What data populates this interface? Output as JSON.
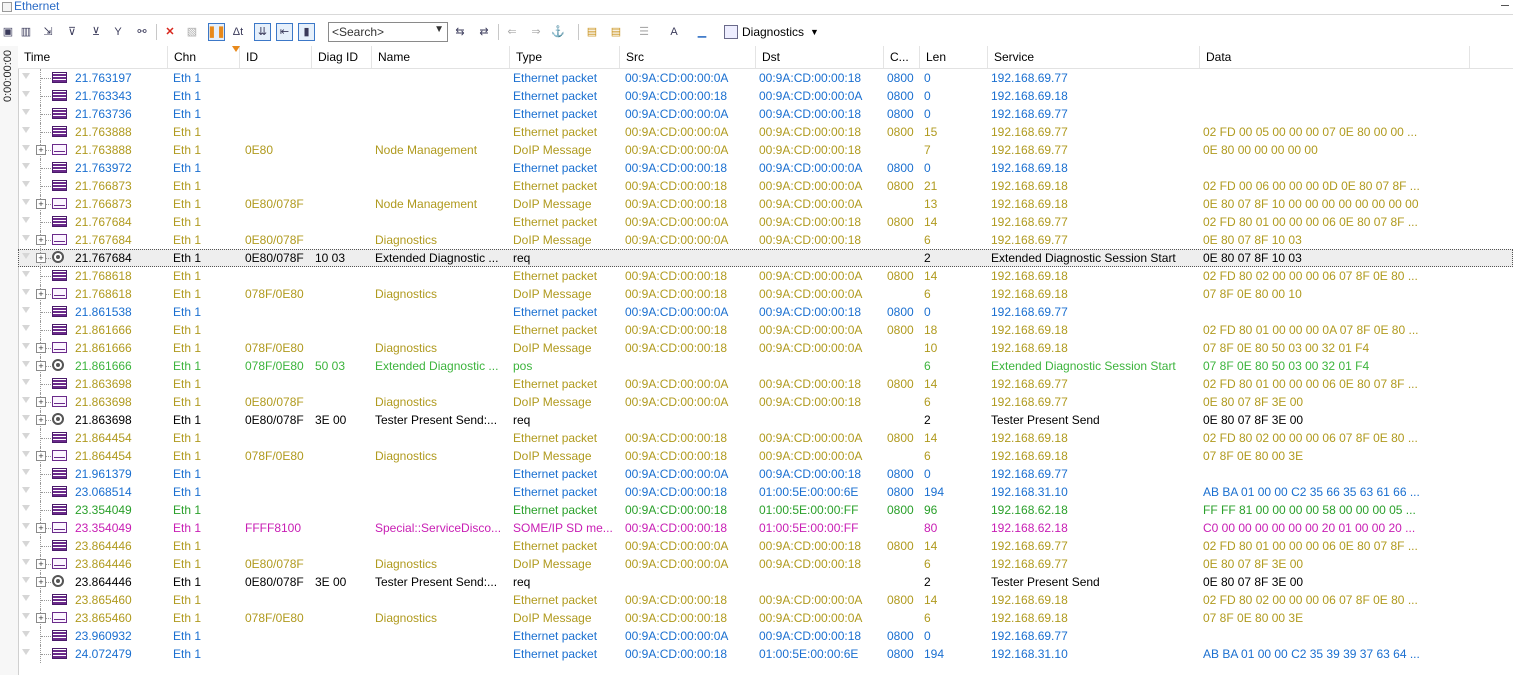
{
  "window": {
    "title": "Ethernet"
  },
  "toolbar": {
    "search_placeholder": "<Search>",
    "filter_label": "Diagnostics"
  },
  "time_strip": "0:00:00:00",
  "columns": [
    "Time",
    "Chn",
    "ID",
    "Diag ID",
    "Name",
    "Type",
    "Src",
    "Dst",
    "C...",
    "Len",
    "Service",
    "Data"
  ],
  "rows": [
    {
      "time": "21.763197",
      "chn": "Eth 1",
      "id": "",
      "diagid": "",
      "name": "",
      "type": "Ethernet packet",
      "src": "00:9A:CD:00:00:0A",
      "dst": "00:9A:CD:00:00:18",
      "c": "0800",
      "len": "0",
      "service": "192.168.69.77",
      "data": "",
      "color": "#1a6fd0",
      "icon": "eth",
      "expander": false
    },
    {
      "time": "21.763343",
      "chn": "Eth 1",
      "id": "",
      "diagid": "",
      "name": "",
      "type": "Ethernet packet",
      "src": "00:9A:CD:00:00:18",
      "dst": "00:9A:CD:00:00:0A",
      "c": "0800",
      "len": "0",
      "service": "192.168.69.18",
      "data": "",
      "color": "#1a6fd0",
      "icon": "eth",
      "expander": false
    },
    {
      "time": "21.763736",
      "chn": "Eth 1",
      "id": "",
      "diagid": "",
      "name": "",
      "type": "Ethernet packet",
      "src": "00:9A:CD:00:00:0A",
      "dst": "00:9A:CD:00:00:18",
      "c": "0800",
      "len": "0",
      "service": "192.168.69.77",
      "data": "",
      "color": "#1a6fd0",
      "icon": "eth",
      "expander": false
    },
    {
      "time": "21.763888",
      "chn": "Eth 1",
      "id": "",
      "diagid": "",
      "name": "",
      "type": "Ethernet packet",
      "src": "00:9A:CD:00:00:0A",
      "dst": "00:9A:CD:00:00:18",
      "c": "0800",
      "len": "15",
      "service": "192.168.69.77",
      "data": "02 FD 00 05 00 00 00 07 0E 80 00 00 ...",
      "color": "#b09a1e",
      "icon": "eth2",
      "expander": false
    },
    {
      "time": "21.763888",
      "chn": "Eth 1",
      "id": "0E80",
      "diagid": "",
      "name": "Node Management",
      "type": "DoIP Message",
      "src": "00:9A:CD:00:00:0A",
      "dst": "00:9A:CD:00:00:18",
      "c": "",
      "len": "7",
      "service": "192.168.69.77",
      "data": "0E 80 00 00 00 00 00",
      "color": "#b09a1e",
      "icon": "msg",
      "expander": true
    },
    {
      "time": "21.763972",
      "chn": "Eth 1",
      "id": "",
      "diagid": "",
      "name": "",
      "type": "Ethernet packet",
      "src": "00:9A:CD:00:00:18",
      "dst": "00:9A:CD:00:00:0A",
      "c": "0800",
      "len": "0",
      "service": "192.168.69.18",
      "data": "",
      "color": "#1a6fd0",
      "icon": "eth",
      "expander": false
    },
    {
      "time": "21.766873",
      "chn": "Eth 1",
      "id": "",
      "diagid": "",
      "name": "",
      "type": "Ethernet packet",
      "src": "00:9A:CD:00:00:18",
      "dst": "00:9A:CD:00:00:0A",
      "c": "0800",
      "len": "21",
      "service": "192.168.69.18",
      "data": "02 FD 00 06 00 00 00 0D 0E 80 07 8F ...",
      "color": "#b09a1e",
      "icon": "eth2",
      "expander": false
    },
    {
      "time": "21.766873",
      "chn": "Eth 1",
      "id": "0E80/078F",
      "diagid": "",
      "name": "Node Management",
      "type": "DoIP Message",
      "src": "00:9A:CD:00:00:18",
      "dst": "00:9A:CD:00:00:0A",
      "c": "",
      "len": "13",
      "service": "192.168.69.18",
      "data": "0E 80 07 8F 10 00 00 00 00 00 00 00 00",
      "color": "#b09a1e",
      "icon": "msg",
      "expander": true
    },
    {
      "time": "21.767684",
      "chn": "Eth 1",
      "id": "",
      "diagid": "",
      "name": "",
      "type": "Ethernet packet",
      "src": "00:9A:CD:00:00:0A",
      "dst": "00:9A:CD:00:00:18",
      "c": "0800",
      "len": "14",
      "service": "192.168.69.77",
      "data": "02 FD 80 01 00 00 00 06 0E 80 07 8F ...",
      "color": "#b09a1e",
      "icon": "eth2",
      "expander": false
    },
    {
      "time": "21.767684",
      "chn": "Eth 1",
      "id": "0E80/078F",
      "diagid": "",
      "name": "Diagnostics",
      "type": "DoIP Message",
      "src": "00:9A:CD:00:00:0A",
      "dst": "00:9A:CD:00:00:18",
      "c": "",
      "len": "6",
      "service": "192.168.69.77",
      "data": "0E 80 07 8F 10 03",
      "color": "#b09a1e",
      "icon": "msg",
      "expander": true
    },
    {
      "time": "21.767684",
      "chn": "Eth 1",
      "id": "0E80/078F",
      "diagid": "10 03",
      "name": "Extended Diagnostic ...",
      "type": "req",
      "src": "",
      "dst": "",
      "c": "",
      "len": "2",
      "service": "Extended Diagnostic Session Start",
      "data": "0E 80 07 8F 10 03",
      "color": "#000000",
      "icon": "diag",
      "expander": true,
      "selected": true
    },
    {
      "time": "21.768618",
      "chn": "Eth 1",
      "id": "",
      "diagid": "",
      "name": "",
      "type": "Ethernet packet",
      "src": "00:9A:CD:00:00:18",
      "dst": "00:9A:CD:00:00:0A",
      "c": "0800",
      "len": "14",
      "service": "192.168.69.18",
      "data": "02 FD 80 02 00 00 00 06 07 8F 0E 80 ...",
      "color": "#b09a1e",
      "icon": "eth2",
      "expander": false
    },
    {
      "time": "21.768618",
      "chn": "Eth 1",
      "id": "078F/0E80",
      "diagid": "",
      "name": "Diagnostics",
      "type": "DoIP Message",
      "src": "00:9A:CD:00:00:18",
      "dst": "00:9A:CD:00:00:0A",
      "c": "",
      "len": "6",
      "service": "192.168.69.18",
      "data": "07 8F 0E 80 00 10",
      "color": "#b09a1e",
      "icon": "msg",
      "expander": true
    },
    {
      "time": "21.861538",
      "chn": "Eth 1",
      "id": "",
      "diagid": "",
      "name": "",
      "type": "Ethernet packet",
      "src": "00:9A:CD:00:00:0A",
      "dst": "00:9A:CD:00:00:18",
      "c": "0800",
      "len": "0",
      "service": "192.168.69.77",
      "data": "",
      "color": "#1a6fd0",
      "icon": "eth",
      "expander": false
    },
    {
      "time": "21.861666",
      "chn": "Eth 1",
      "id": "",
      "diagid": "",
      "name": "",
      "type": "Ethernet packet",
      "src": "00:9A:CD:00:00:18",
      "dst": "00:9A:CD:00:00:0A",
      "c": "0800",
      "len": "18",
      "service": "192.168.69.18",
      "data": "02 FD 80 01 00 00 00 0A 07 8F 0E 80 ...",
      "color": "#b09a1e",
      "icon": "eth2",
      "expander": false
    },
    {
      "time": "21.861666",
      "chn": "Eth 1",
      "id": "078F/0E80",
      "diagid": "",
      "name": "Diagnostics",
      "type": "DoIP Message",
      "src": "00:9A:CD:00:00:18",
      "dst": "00:9A:CD:00:00:0A",
      "c": "",
      "len": "10",
      "service": "192.168.69.18",
      "data": "07 8F 0E 80 50 03 00 32 01 F4",
      "color": "#b09a1e",
      "icon": "msg",
      "expander": true
    },
    {
      "time": "21.861666",
      "chn": "Eth 1",
      "id": "078F/0E80",
      "diagid": "50 03",
      "name": "Extended Diagnostic ...",
      "type": "pos",
      "src": "",
      "dst": "",
      "c": "",
      "len": "6",
      "service": "Extended Diagnostic Session Start",
      "data": "07 8F 0E 80 50 03 00 32 01 F4",
      "color": "#3cb43c",
      "icon": "diag",
      "expander": true
    },
    {
      "time": "21.863698",
      "chn": "Eth 1",
      "id": "",
      "diagid": "",
      "name": "",
      "type": "Ethernet packet",
      "src": "00:9A:CD:00:00:0A",
      "dst": "00:9A:CD:00:00:18",
      "c": "0800",
      "len": "14",
      "service": "192.168.69.77",
      "data": "02 FD 80 01 00 00 00 06 0E 80 07 8F ...",
      "color": "#b09a1e",
      "icon": "eth2",
      "expander": false
    },
    {
      "time": "21.863698",
      "chn": "Eth 1",
      "id": "0E80/078F",
      "diagid": "",
      "name": "Diagnostics",
      "type": "DoIP Message",
      "src": "00:9A:CD:00:00:0A",
      "dst": "00:9A:CD:00:00:18",
      "c": "",
      "len": "6",
      "service": "192.168.69.77",
      "data": "0E 80 07 8F 3E 00",
      "color": "#b09a1e",
      "icon": "msg",
      "expander": true
    },
    {
      "time": "21.863698",
      "chn": "Eth 1",
      "id": "0E80/078F",
      "diagid": "3E 00",
      "name": "Tester Present Send:...",
      "type": "req",
      "src": "",
      "dst": "",
      "c": "",
      "len": "2",
      "service": "Tester Present Send",
      "data": "0E 80 07 8F 3E 00",
      "color": "#000000",
      "icon": "diag",
      "expander": true
    },
    {
      "time": "21.864454",
      "chn": "Eth 1",
      "id": "",
      "diagid": "",
      "name": "",
      "type": "Ethernet packet",
      "src": "00:9A:CD:00:00:18",
      "dst": "00:9A:CD:00:00:0A",
      "c": "0800",
      "len": "14",
      "service": "192.168.69.18",
      "data": "02 FD 80 02 00 00 00 06 07 8F 0E 80 ...",
      "color": "#b09a1e",
      "icon": "eth2",
      "expander": false
    },
    {
      "time": "21.864454",
      "chn": "Eth 1",
      "id": "078F/0E80",
      "diagid": "",
      "name": "Diagnostics",
      "type": "DoIP Message",
      "src": "00:9A:CD:00:00:18",
      "dst": "00:9A:CD:00:00:0A",
      "c": "",
      "len": "6",
      "service": "192.168.69.18",
      "data": "07 8F 0E 80 00 3E",
      "color": "#b09a1e",
      "icon": "msg",
      "expander": true
    },
    {
      "time": "21.961379",
      "chn": "Eth 1",
      "id": "",
      "diagid": "",
      "name": "",
      "type": "Ethernet packet",
      "src": "00:9A:CD:00:00:0A",
      "dst": "00:9A:CD:00:00:18",
      "c": "0800",
      "len": "0",
      "service": "192.168.69.77",
      "data": "",
      "color": "#1a6fd0",
      "icon": "eth",
      "expander": false
    },
    {
      "time": "23.068514",
      "chn": "Eth 1",
      "id": "",
      "diagid": "",
      "name": "",
      "type": "Ethernet packet",
      "src": "00:9A:CD:00:00:18",
      "dst": "01:00:5E:00:00:6E",
      "c": "0800",
      "len": "194",
      "service": "192.168.31.10",
      "data": "AB BA 01 00 00 C2 35 66 35 63 61 66 ...",
      "color": "#1a6fd0",
      "icon": "eth",
      "expander": false
    },
    {
      "time": "23.354049",
      "chn": "Eth 1",
      "id": "",
      "diagid": "",
      "name": "",
      "type": "Ethernet packet",
      "src": "00:9A:CD:00:00:18",
      "dst": "01:00:5E:00:00:FF",
      "c": "0800",
      "len": "96",
      "service": "192.168.62.18",
      "data": "FF FF 81 00 00 00 00 58 00 00 00 05 ...",
      "color": "#2aa02a",
      "icon": "eth",
      "expander": false
    },
    {
      "time": "23.354049",
      "chn": "Eth 1",
      "id": "FFFF8100",
      "diagid": "",
      "name": "Special::ServiceDisco...",
      "type": "SOME/IP SD me...",
      "src": "00:9A:CD:00:00:18",
      "dst": "01:00:5E:00:00:FF",
      "c": "",
      "len": "80",
      "service": "192.168.62.18",
      "data": "C0 00 00 00 00 00 00 20 01 00 00 20 ...",
      "color": "#c81eb4",
      "icon": "msg",
      "expander": true
    },
    {
      "time": "23.864446",
      "chn": "Eth 1",
      "id": "",
      "diagid": "",
      "name": "",
      "type": "Ethernet packet",
      "src": "00:9A:CD:00:00:0A",
      "dst": "00:9A:CD:00:00:18",
      "c": "0800",
      "len": "14",
      "service": "192.168.69.77",
      "data": "02 FD 80 01 00 00 00 06 0E 80 07 8F ...",
      "color": "#b09a1e",
      "icon": "eth2",
      "expander": false
    },
    {
      "time": "23.864446",
      "chn": "Eth 1",
      "id": "0E80/078F",
      "diagid": "",
      "name": "Diagnostics",
      "type": "DoIP Message",
      "src": "00:9A:CD:00:00:0A",
      "dst": "00:9A:CD:00:00:18",
      "c": "",
      "len": "6",
      "service": "192.168.69.77",
      "data": "0E 80 07 8F 3E 00",
      "color": "#b09a1e",
      "icon": "msg",
      "expander": true
    },
    {
      "time": "23.864446",
      "chn": "Eth 1",
      "id": "0E80/078F",
      "diagid": "3E 00",
      "name": "Tester Present Send:...",
      "type": "req",
      "src": "",
      "dst": "",
      "c": "",
      "len": "2",
      "service": "Tester Present Send",
      "data": "0E 80 07 8F 3E 00",
      "color": "#000000",
      "icon": "diag",
      "expander": true
    },
    {
      "time": "23.865460",
      "chn": "Eth 1",
      "id": "",
      "diagid": "",
      "name": "",
      "type": "Ethernet packet",
      "src": "00:9A:CD:00:00:18",
      "dst": "00:9A:CD:00:00:0A",
      "c": "0800",
      "len": "14",
      "service": "192.168.69.18",
      "data": "02 FD 80 02 00 00 00 06 07 8F 0E 80 ...",
      "color": "#b09a1e",
      "icon": "eth2",
      "expander": false
    },
    {
      "time": "23.865460",
      "chn": "Eth 1",
      "id": "078F/0E80",
      "diagid": "",
      "name": "Diagnostics",
      "type": "DoIP Message",
      "src": "00:9A:CD:00:00:18",
      "dst": "00:9A:CD:00:00:0A",
      "c": "",
      "len": "6",
      "service": "192.168.69.18",
      "data": "07 8F 0E 80 00 3E",
      "color": "#b09a1e",
      "icon": "msg",
      "expander": true
    },
    {
      "time": "23.960932",
      "chn": "Eth 1",
      "id": "",
      "diagid": "",
      "name": "",
      "type": "Ethernet packet",
      "src": "00:9A:CD:00:00:0A",
      "dst": "00:9A:CD:00:00:18",
      "c": "0800",
      "len": "0",
      "service": "192.168.69.77",
      "data": "",
      "color": "#1a6fd0",
      "icon": "eth",
      "expander": false
    },
    {
      "time": "24.072479",
      "chn": "Eth 1",
      "id": "",
      "diagid": "",
      "name": "",
      "type": "Ethernet packet",
      "src": "00:9A:CD:00:00:18",
      "dst": "01:00:5E:00:00:6E",
      "c": "0800",
      "len": "194",
      "service": "192.168.31.10",
      "data": "AB BA 01 00 00 C2 35 39 39 37 63 64 ...",
      "color": "#1a6fd0",
      "icon": "eth",
      "expander": false
    }
  ]
}
